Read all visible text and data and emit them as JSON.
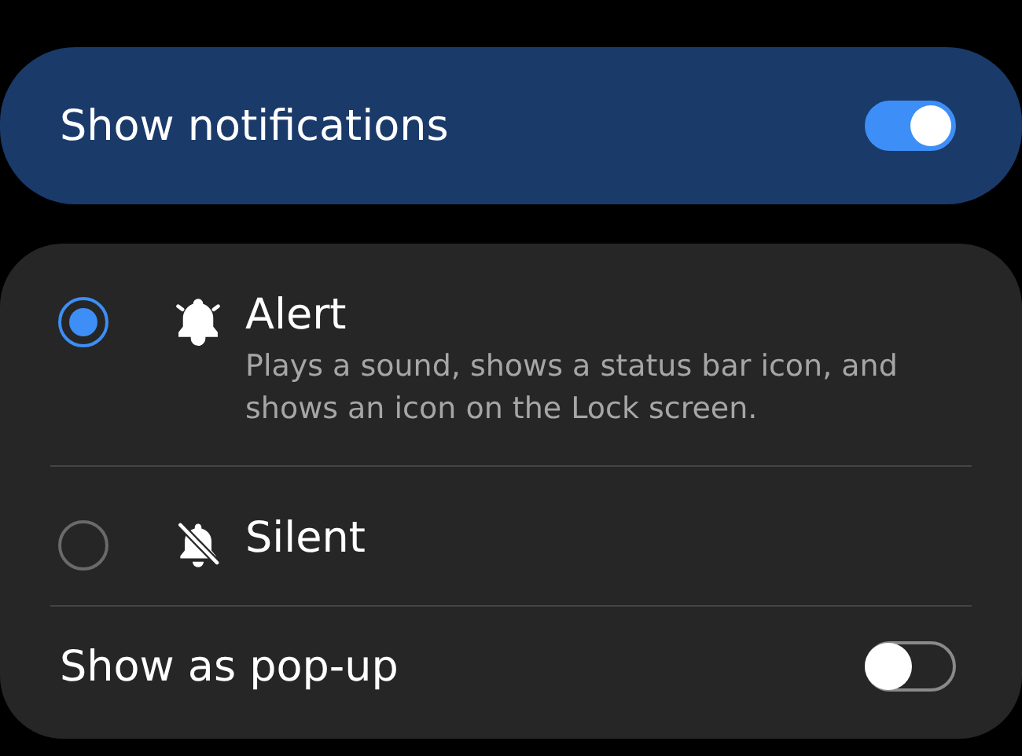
{
  "show_notifications": {
    "label": "Show notifications",
    "on": true
  },
  "options": [
    {
      "kind": "sound",
      "label": "Alert",
      "description": "Plays a sound, shows a status bar icon, and shows an icon on the Lock screen.",
      "selected": true
    },
    {
      "kind": "muted",
      "label": "Silent",
      "selected": false
    }
  ],
  "popup": {
    "label": "Show as pop-up",
    "on": false
  }
}
